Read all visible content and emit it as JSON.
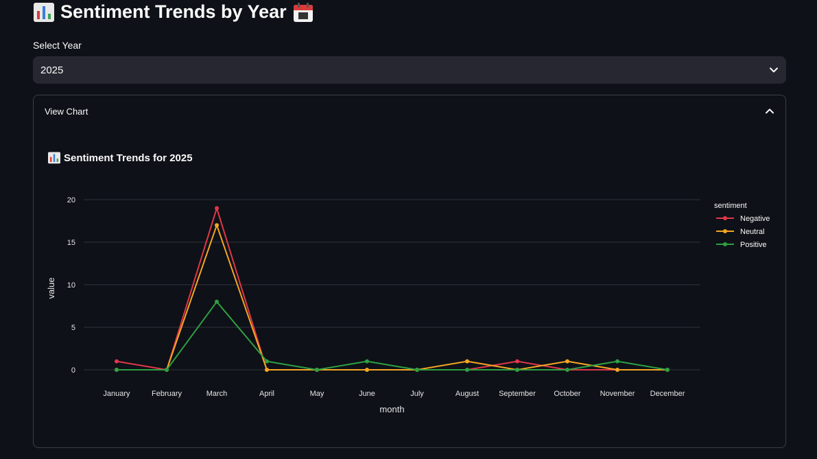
{
  "header": {
    "title": "Sentiment Trends by Year",
    "title_icon": "bar-chart-icon",
    "title_icon_2": "calendar-icon"
  },
  "year_select": {
    "label": "Select Year",
    "value": "2025"
  },
  "expander": {
    "label": "View Chart",
    "state": "expanded"
  },
  "chart_section": {
    "title": "Sentiment Trends for 2025",
    "title_icon": "bar-chart-icon"
  },
  "colors": {
    "Negative": "#e0374a",
    "Neutral": "#f5a623",
    "Positive": "#2ea043"
  },
  "chart_data": {
    "type": "line",
    "x": [
      "January",
      "February",
      "March",
      "April",
      "May",
      "June",
      "July",
      "August",
      "September",
      "October",
      "November",
      "December"
    ],
    "xlabel": "month",
    "ylabel": "value",
    "ylim": [
      0,
      20
    ],
    "yticks": [
      0,
      5,
      10,
      15,
      20
    ],
    "grid": true,
    "legend_title": "sentiment",
    "legend_position": "right",
    "series": [
      {
        "name": "Negative",
        "values": [
          1,
          0,
          19,
          0,
          0,
          0,
          0,
          0,
          1,
          0,
          0,
          0
        ]
      },
      {
        "name": "Neutral",
        "values": [
          0,
          0,
          17,
          0,
          0,
          0,
          0,
          1,
          0,
          1,
          0,
          0
        ]
      },
      {
        "name": "Positive",
        "values": [
          0,
          0,
          8,
          1,
          0,
          1,
          0,
          0,
          0,
          0,
          1,
          0
        ]
      }
    ]
  }
}
